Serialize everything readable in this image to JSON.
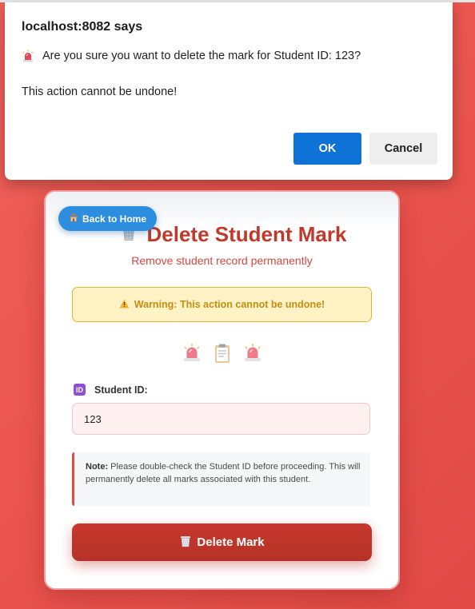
{
  "dialog": {
    "title": "localhost:8082 says",
    "message": "Are you sure you want to delete the mark for Student ID: 123?",
    "message2": "This action cannot be undone!",
    "ok_label": "OK",
    "cancel_label": "Cancel"
  },
  "card": {
    "back_label": "Back to Home",
    "title": "Delete Student Mark",
    "subtitle": "Remove student record permanently",
    "warning": "Warning: This action cannot be undone!",
    "student_id_label": "Student ID:",
    "student_id_value": "123",
    "note_label": "Note:",
    "note_text": " Please double-check the Student ID before proceeding. This will permanently delete all marks associated with this student.",
    "delete_label": "Delete Mark",
    "icons": [
      "siren-icon",
      "clipboard-icon",
      "siren-icon"
    ]
  },
  "colors": {
    "background": "#e9524c",
    "ok_button": "#0f72d6",
    "back_button": "#2d8ee0",
    "title": "#c0392b",
    "delete_button": "#b53228",
    "warning_bg": "#fff3c6"
  }
}
